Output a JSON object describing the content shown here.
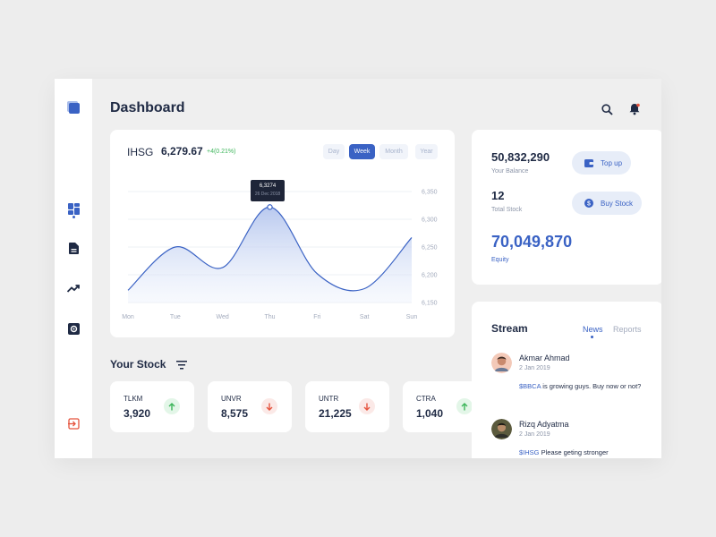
{
  "header": {
    "title": "Dashboard"
  },
  "sidebar": {
    "items": [
      {
        "name": "dashboard",
        "icon": "dashboard-grid-icon",
        "active": true
      },
      {
        "name": "documents",
        "icon": "document-icon",
        "active": false
      },
      {
        "name": "trends",
        "icon": "trending-up-icon",
        "active": false
      },
      {
        "name": "settings",
        "icon": "settings-icon",
        "active": false
      }
    ],
    "logout_icon": "logout-icon"
  },
  "chart_card": {
    "name": "IHSG",
    "value": "6,279.67",
    "change": "+4(0.21%)",
    "periods": [
      "Day",
      "Week",
      "Month",
      "Year"
    ],
    "active_period": "Week",
    "tooltip": {
      "value": "6,3274",
      "date": "26 Dec 2018"
    }
  },
  "chart_data": {
    "type": "area",
    "x": [
      "Mon",
      "Tue",
      "Wed",
      "Thu",
      "Fri",
      "Sat",
      "Sun"
    ],
    "yticks": [
      6150,
      6200,
      6250,
      6300,
      6350
    ],
    "ytick_labels": [
      "6,150",
      "6,200",
      "6,250",
      "6,300",
      "6,350"
    ],
    "ylim": [
      6150,
      6350
    ],
    "grid": true,
    "points": [
      {
        "x": "Mon",
        "y": 6172
      },
      {
        "x": "Tue",
        "y": 6250
      },
      {
        "x": "Wed",
        "y": 6213
      },
      {
        "x": "Thu",
        "y": 6322
      },
      {
        "x": "Fri",
        "y": 6202
      },
      {
        "x": "Sat",
        "y": 6175
      },
      {
        "x": "Sun",
        "y": 6267
      }
    ],
    "highlight_index": 3,
    "line_color": "#3a62c4"
  },
  "stocks": {
    "title": "Your Stock",
    "items": [
      {
        "code": "TLKM",
        "price": "3,920",
        "trend": "up"
      },
      {
        "code": "UNVR",
        "price": "8,575",
        "trend": "down"
      },
      {
        "code": "UNTR",
        "price": "21,225",
        "trend": "down"
      },
      {
        "code": "CTRA",
        "price": "1,040",
        "trend": "up"
      }
    ]
  },
  "balance": {
    "amount": "50,832,290",
    "amount_label": "Your Balance",
    "total_stock": "12",
    "total_stock_label": "Total Stock",
    "equity": "70,049,870",
    "equity_label": "Equity",
    "topup_label": "Top up",
    "buy_label": "Buy Stock"
  },
  "stream": {
    "title": "Stream",
    "tabs": [
      "News",
      "Reports"
    ],
    "active_tab": "News",
    "posts": [
      {
        "author": "Akmar Ahmad",
        "date": "2 Jan 2019",
        "tag": "$BBCA",
        "text": " is growing guys. Buy now or not?"
      },
      {
        "author": "Rizq Adyatma",
        "date": "2 Jan 2019",
        "tag": "$IHSG",
        "text": " Please geting stronger"
      }
    ]
  },
  "colors": {
    "accent": "#3a62c4",
    "up": "#3cb55a",
    "down": "#e5533d",
    "dark": "#1f2a44"
  }
}
